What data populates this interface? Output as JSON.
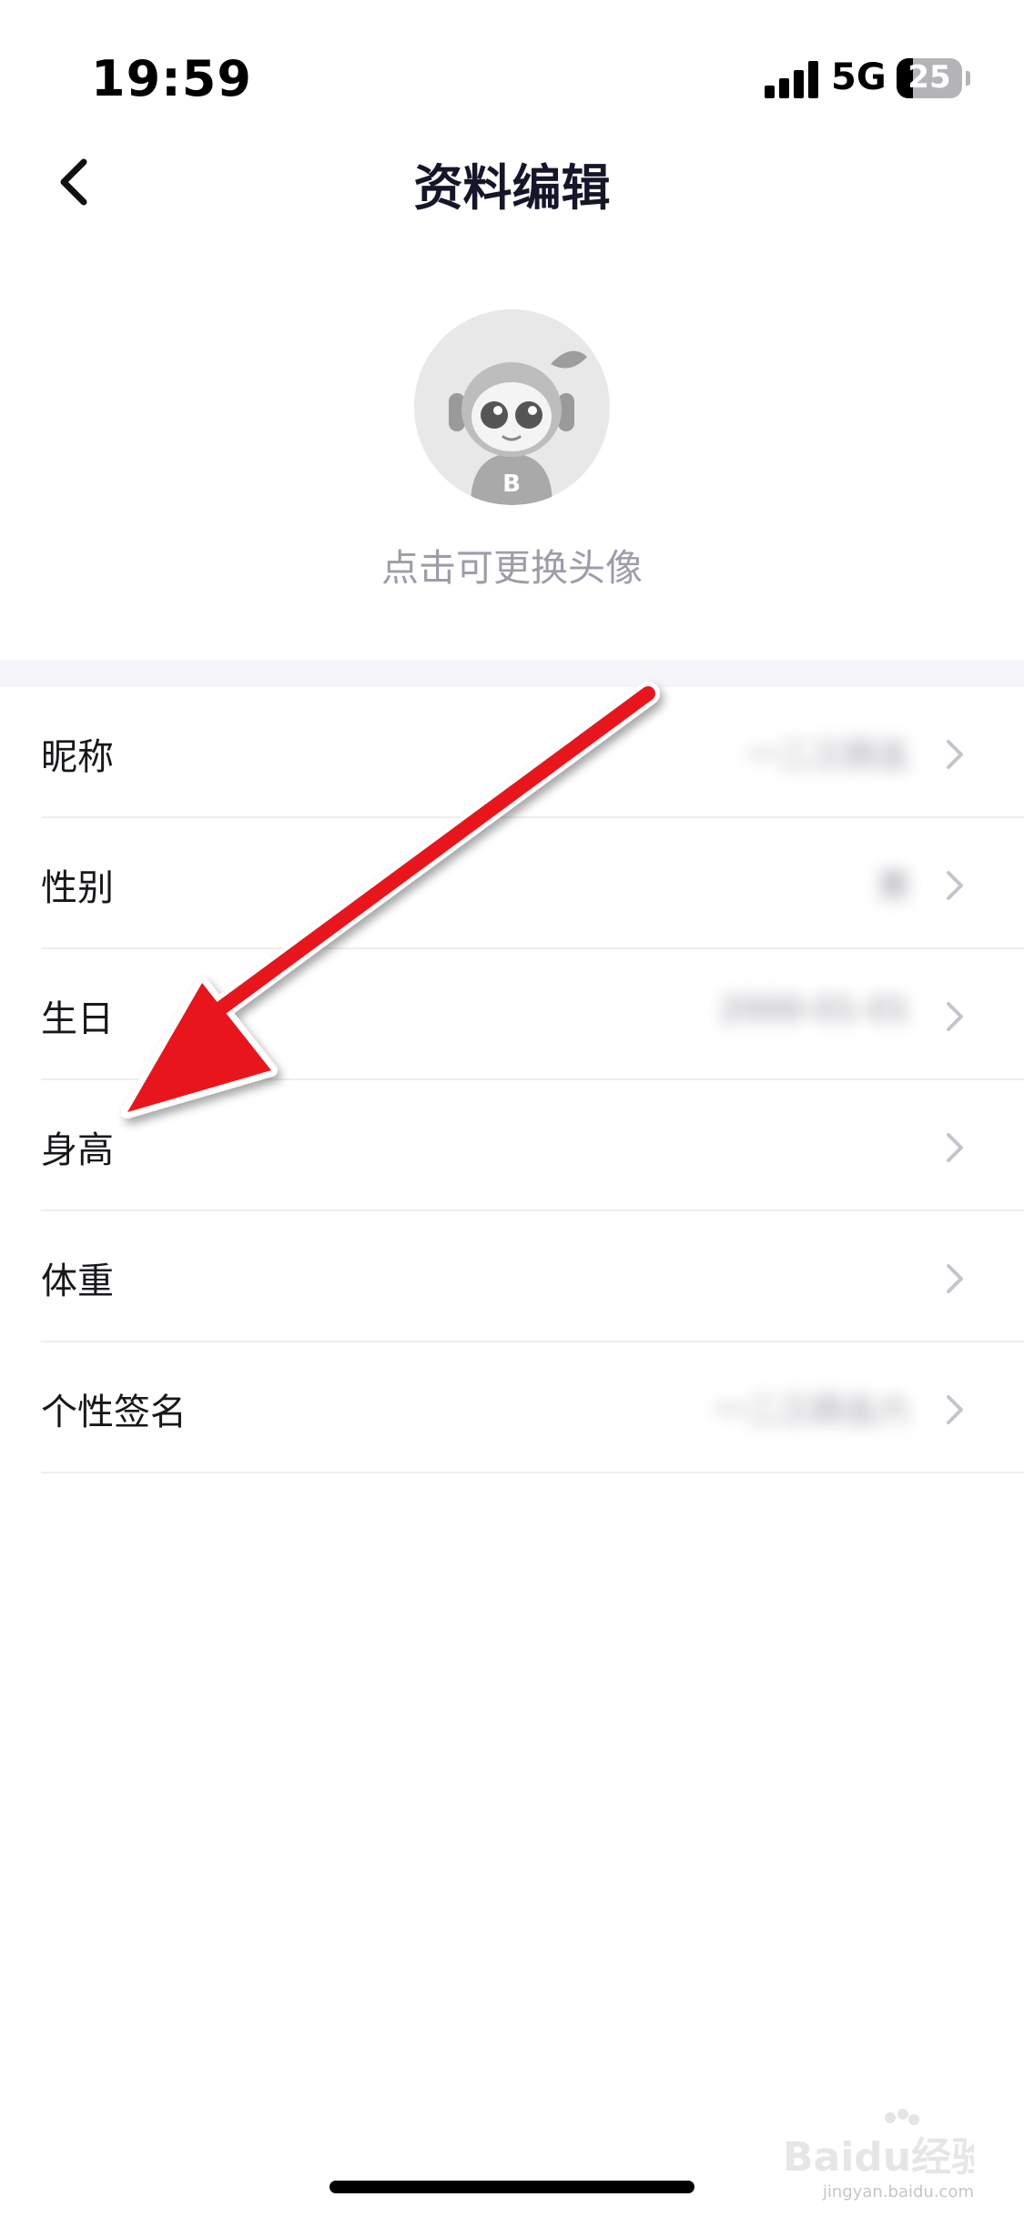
{
  "status_bar": {
    "time": "19:59",
    "network": "5G",
    "battery_level": "25",
    "battery_fraction": 0.25
  },
  "nav": {
    "title": "资料编辑",
    "back_icon": "chevron-left-icon"
  },
  "avatar": {
    "hint": "点击可更换头像"
  },
  "profile_rows": [
    {
      "label": "昵称",
      "value": "一二三四五"
    },
    {
      "label": "性别",
      "value": "男"
    },
    {
      "label": "生日",
      "value": "2000-01-01"
    },
    {
      "label": "身高",
      "value": ""
    },
    {
      "label": "体重",
      "value": ""
    },
    {
      "label": "个性签名",
      "value": "一二三四五六"
    }
  ],
  "colors": {
    "annotation_arrow": "#e8191e",
    "section_gap": "#f6f6f9",
    "hint_text": "#9d9daa"
  },
  "watermark": {
    "logo": "Baidu经验",
    "url": "jingyan.baidu.com"
  }
}
